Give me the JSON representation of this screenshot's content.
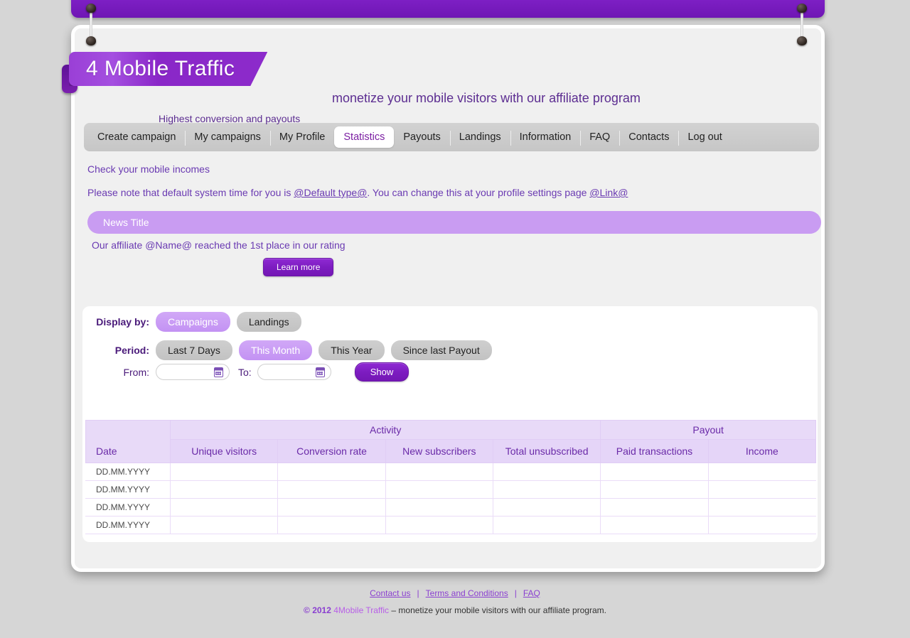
{
  "brand": {
    "logo_text": "4 Mobile Traffic",
    "tagline": "monetize your mobile visitors with our affiliate program",
    "subtagline": "Highest conversion and payouts"
  },
  "nav": {
    "items": [
      {
        "label": "Create campaign",
        "active": false
      },
      {
        "label": "My campaigns",
        "active": false
      },
      {
        "label": "My Profile",
        "active": false
      },
      {
        "label": "Statistics",
        "active": true
      },
      {
        "label": "Payouts",
        "active": false
      },
      {
        "label": "Landings",
        "active": false
      },
      {
        "label": "Information",
        "active": false
      },
      {
        "label": "FAQ",
        "active": false
      },
      {
        "label": "Contacts",
        "active": false
      },
      {
        "label": "Log out",
        "active": false
      }
    ]
  },
  "info": {
    "heading": "Check your mobile incomes",
    "note_before": "Please note that default system time for you is ",
    "note_link_1": "@Default type@",
    "note_middle": ". You can change this at your profile settings page ",
    "note_link_2": "@Link@ "
  },
  "news": {
    "title": "News Title",
    "body": "Our affiliate @Name@ reached the 1st place in our rating",
    "button_label": "Learn more"
  },
  "filters": {
    "display_label": "Display by:",
    "display_options": [
      {
        "label": "Campaigns",
        "selected": true
      },
      {
        "label": "Landings",
        "selected": false
      }
    ],
    "period_label": "Period:",
    "period_options": [
      {
        "label": "Last 7 Days",
        "selected": false
      },
      {
        "label": "This Month",
        "selected": true
      },
      {
        "label": "This Year",
        "selected": false
      },
      {
        "label": "Since last Payout",
        "selected": false
      }
    ],
    "from_label": "From:",
    "from_value": "",
    "from_placeholder": "",
    "to_label": "To:",
    "to_value": "",
    "to_placeholder": "",
    "show_label": "Show"
  },
  "table": {
    "date_header": "Date",
    "groups": [
      {
        "label": "Activity",
        "span": 4
      },
      {
        "label": "Payout",
        "span": 2
      }
    ],
    "columns": [
      "Unique visitors",
      "Conversion rate",
      "New subscribers",
      "Total unsubscribed",
      "Paid transactions",
      "Income"
    ],
    "rows": [
      {
        "date": "DD.MM.YYYY",
        "values": [
          "",
          "",
          "",
          "",
          "",
          ""
        ]
      },
      {
        "date": "DD.MM.YYYY",
        "values": [
          "",
          "",
          "",
          "",
          "",
          ""
        ]
      },
      {
        "date": "DD.MM.YYYY",
        "values": [
          "",
          "",
          "",
          "",
          "",
          ""
        ]
      },
      {
        "date": "DD.MM.YYYY",
        "values": [
          "",
          "",
          "",
          "",
          "",
          ""
        ]
      }
    ]
  },
  "footer": {
    "links": [
      {
        "label": "Contact us"
      },
      {
        "label": "Terms and Conditions"
      },
      {
        "label": "FAQ"
      }
    ],
    "separator": "|",
    "copyright_mark": "© 2012",
    "copyright_brand": "4Mobile Traffic",
    "copyright_rest": "– monetize your mobile visitors with our affiliate program."
  },
  "colors": {
    "brand_purple": "#7b1fa2",
    "accent_light": "#c99cf2",
    "header_bg": "#e8daf8"
  }
}
